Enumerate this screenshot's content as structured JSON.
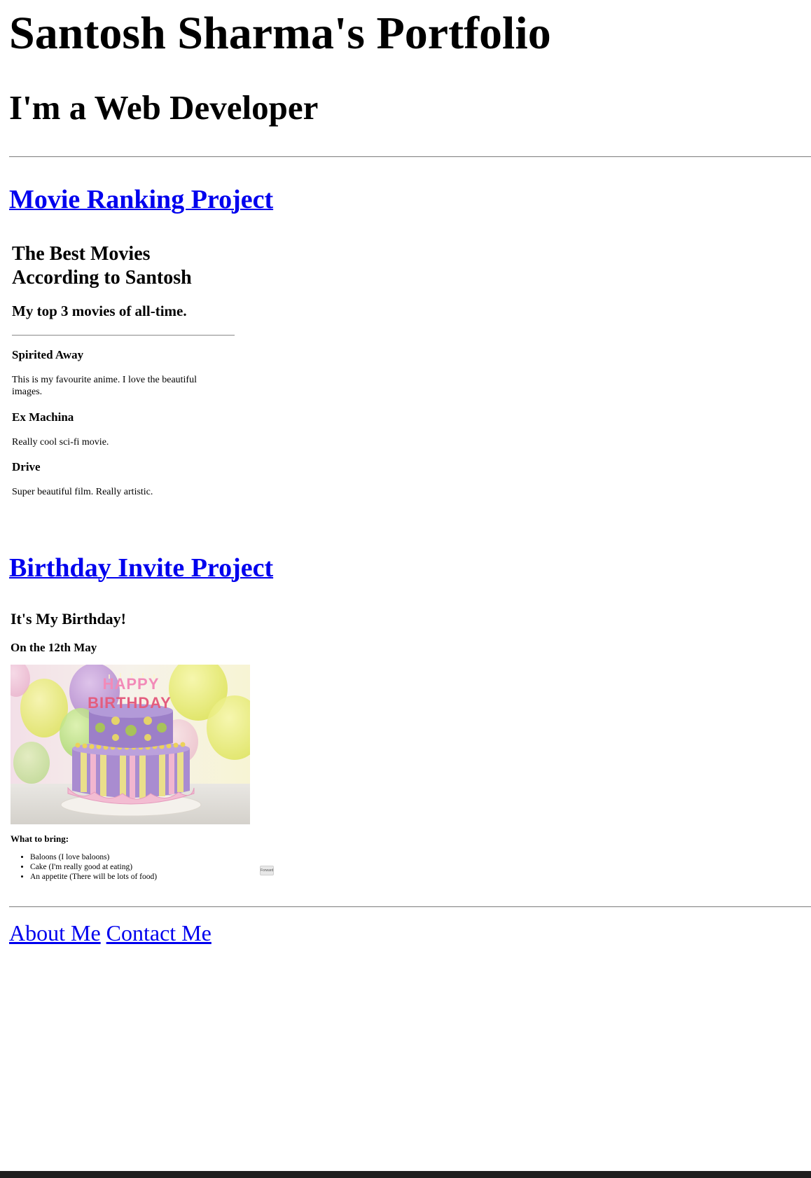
{
  "header": {
    "title": "Santosh Sharma's Portfolio",
    "subtitle": "I'm a Web Developer"
  },
  "projects": {
    "movie": {
      "link": "Movie Ranking Project",
      "title": "The Best Movies According to Santosh",
      "subtitle": "My top 3 movies of all-time.",
      "movies": [
        {
          "name": "Spirited Away",
          "desc": "This is my favourite anime. I love the beautiful images."
        },
        {
          "name": "Ex Machina",
          "desc": "Really cool sci-fi movie."
        },
        {
          "name": "Drive",
          "desc": "Super beautiful film. Really artistic."
        }
      ]
    },
    "birthday": {
      "link": "Birthday Invite Project",
      "title": "It's My Birthday!",
      "date": "On the 12th May",
      "image_alt": "birthday cake",
      "cake_text_top": "HAPPY",
      "cake_text_bottom": "BIRTHDAY",
      "bring_heading": "What to bring:",
      "items": [
        "Baloons (I love baloons)",
        "Cake (I'm really good at eating)",
        "An appetite (There will be lots of food)"
      ],
      "mini_button": "Forward"
    }
  },
  "footer": {
    "about": "About Me",
    "contact": "Contact Me"
  },
  "colors": {
    "link": "#0000ee",
    "text": "#000000",
    "bottom_bar": "#1e1e1e"
  }
}
